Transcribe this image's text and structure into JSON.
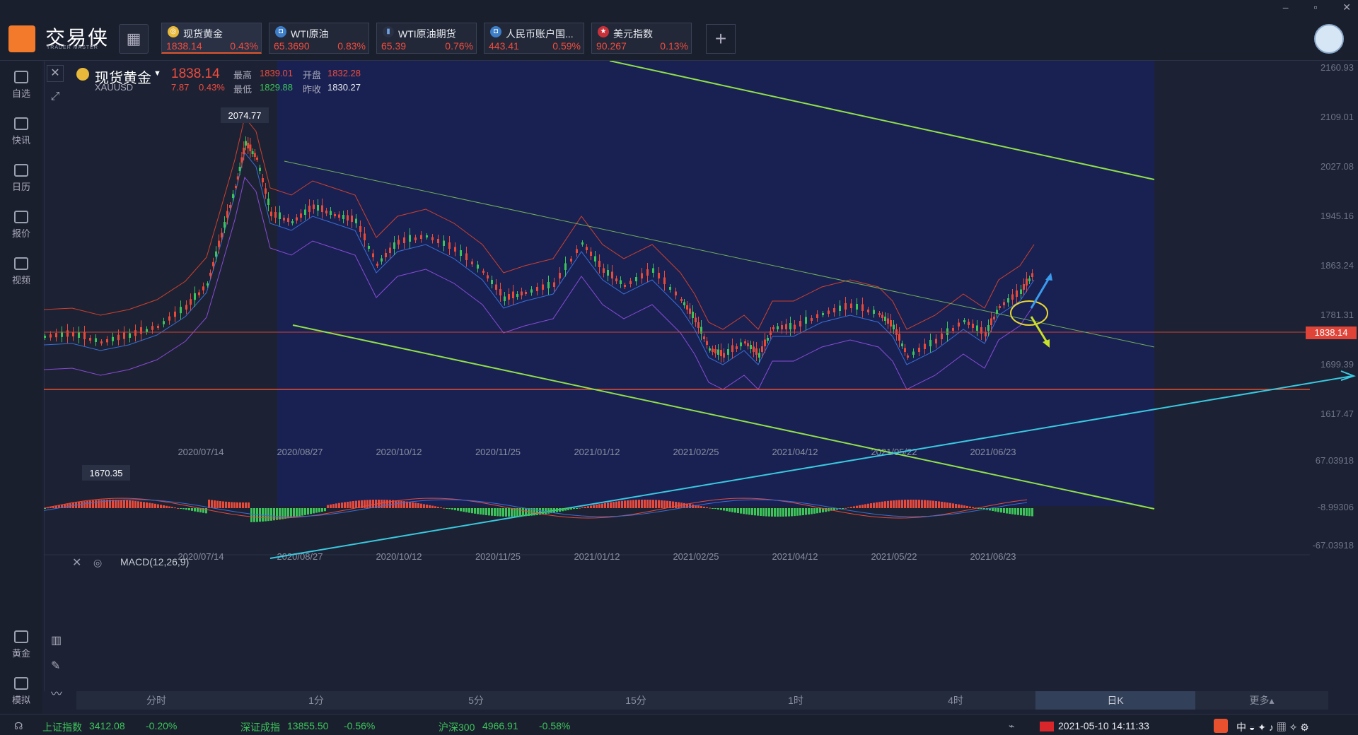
{
  "app": {
    "brand": "交易侠",
    "brand_sub": "TRADER MASTER"
  },
  "window": {
    "minimize": "–",
    "restore": "▫",
    "close": "✕"
  },
  "tabs": [
    {
      "name": "现货黄金",
      "price": "1838.14",
      "change": "0.43%",
      "icon": "coin-icon",
      "active": true
    },
    {
      "name": "WTI原油",
      "price": "65.3690",
      "change": "0.83%",
      "icon": "oil-icon",
      "active": false
    },
    {
      "name": "WTI原油期货",
      "price": "65.39",
      "change": "0.76%",
      "icon": "futures-icon",
      "active": false
    },
    {
      "name": "人民币账户国...",
      "price": "443.41",
      "change": "0.59%",
      "icon": "rmb-icon",
      "active": false
    },
    {
      "name": "美元指数",
      "price": "90.267",
      "change": "0.13%",
      "icon": "us-flag-icon",
      "active": false
    }
  ],
  "sidebar": {
    "items": [
      {
        "label": "自选",
        "icon": "bookmark-icon"
      },
      {
        "label": "快讯",
        "icon": "news-icon"
      },
      {
        "label": "日历",
        "icon": "calendar-icon"
      },
      {
        "label": "报价",
        "icon": "quote-icon"
      },
      {
        "label": "视频",
        "icon": "video-icon"
      },
      {
        "label": "黄金",
        "icon": "gold-icon"
      },
      {
        "label": "模拟",
        "icon": "simulate-icon"
      }
    ]
  },
  "quote": {
    "name": "现货黄金",
    "code": "XAUUSD",
    "price": "1838.14",
    "change": "7.87",
    "pct": "0.43%",
    "high_label": "最高",
    "high": "1839.01",
    "open_label": "开盘",
    "open": "1832.28",
    "low_label": "最低",
    "low": "1829.88",
    "prev_label": "昨收",
    "prev": "1830.27"
  },
  "chart_data": {
    "type": "candlestick",
    "symbol": "XAUUSD",
    "y_ticks": [
      "2160.93",
      "2109.01",
      "2027.08",
      "1945.16",
      "1863.24",
      "1781.31",
      "1699.39",
      "1617.47"
    ],
    "x_ticks": [
      "2020/07/14",
      "2020/08/27",
      "2020/10/12",
      "2020/11/25",
      "2021/01/12",
      "2021/02/25",
      "2021/04/12",
      "2021/05/22",
      "2021/06/23"
    ],
    "current_price": "1838.14",
    "high_annotation": "2074.77",
    "low_annotation": "1670.35",
    "macd": {
      "label": "MACD(12,26,9)",
      "y_ticks": [
        "67.03918",
        "-8.99306",
        "-67.03918"
      ]
    }
  },
  "timeframes": [
    "分时",
    "1分",
    "5分",
    "15分",
    "1时",
    "4时",
    "日K",
    "更多▴"
  ],
  "active_timeframe": "日K",
  "status": {
    "indices": [
      {
        "name": "上证指数",
        "value": "3412.08",
        "change": "-0.20%"
      },
      {
        "name": "深证成指",
        "value": "13855.50",
        "change": "-0.56%"
      },
      {
        "name": "沪深300",
        "value": "4966.91",
        "change": "-0.58%"
      }
    ],
    "datetime": "2021-05-10 14:11:33"
  }
}
